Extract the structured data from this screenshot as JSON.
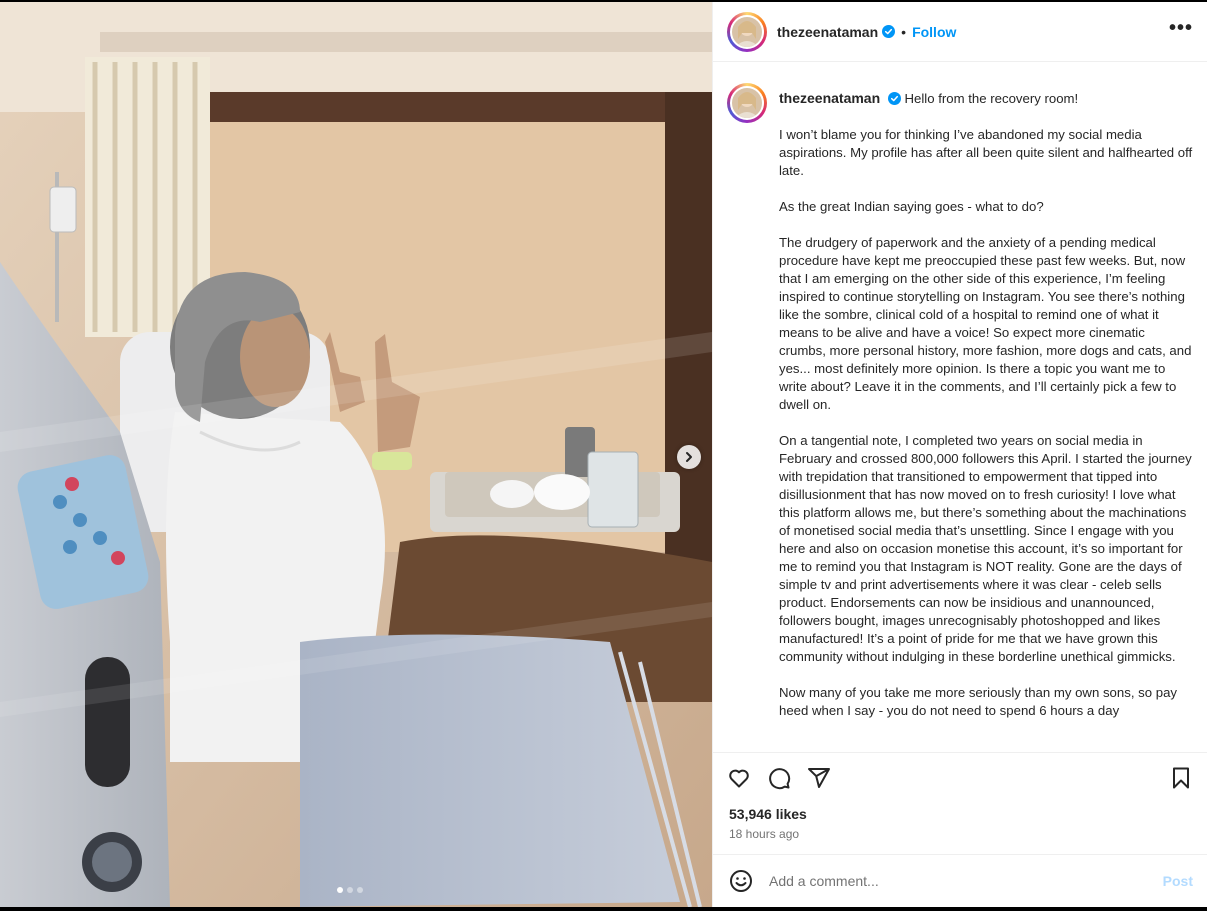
{
  "post": {
    "username": "thezeenataman",
    "verified": true,
    "follow_label": "Follow",
    "separator": "•",
    "more_label": "•••",
    "carousel": {
      "count": 3,
      "active_index": 0
    }
  },
  "caption": {
    "username": "thezeenataman",
    "first_line": "Hello from the recovery room!",
    "paragraphs": [
      "I won’t blame you for thinking I’ve abandoned my social media aspirations. My profile has after all been quite silent and halfhearted off late.",
      "As the great Indian saying goes - what to do?",
      "The drudgery of paperwork and the anxiety of a pending medical procedure have kept me preoccupied these past few weeks. But, now that I am emerging on the other side of this experience, I’m feeling inspired to continue storytelling on Instagram. You see there’s nothing like the sombre, clinical cold of a hospital to remind one of what it means to be alive and have a voice! So expect more cinematic crumbs, more personal history, more fashion, more dogs and cats, and yes... most definitely more opinion. Is there a topic you want me to write about? Leave it in the comments, and I’ll certainly pick a few to dwell on.",
      "On a tangential note, I completed two years on social media in February and crossed 800,000 followers this April. I started the journey with trepidation that transitioned to empowerment that tipped into disillusionment that has now moved on to fresh curiosity! I love what this platform allows me, but there’s something about the machinations of monetised social media that’s unsettling. Since I engage with you here and also on occasion monetise this account, it’s so important for me to remind you that Instagram is NOT reality. Gone are the days of simple tv and print advertisements where it was clear - celeb sells product. Endorsements can now be insidious and unannounced, followers bought, images unrecognisably photoshopped and likes manufactured! It’s a point of pride for me that we have grown this community without indulging in these borderline unethical gimmicks.",
      "Now many of you take me more seriously than my own sons, so pay heed when I say - you do not need to spend 6 hours a day"
    ]
  },
  "stats": {
    "likes": "53,946 likes",
    "time_ago": "18 hours ago"
  },
  "comment": {
    "placeholder": "Add a comment...",
    "post_label": "Post"
  },
  "colors": {
    "accent": "#0095f6",
    "post_disabled": "#b3dbff",
    "muted": "#737373",
    "text": "#262626"
  },
  "icons": {
    "like": "heart-icon",
    "comment": "comment-bubble-icon",
    "share": "paper-plane-icon",
    "save": "bookmark-icon",
    "emoji": "smiley-icon",
    "more": "more-options-icon",
    "next": "chevron-right-icon"
  }
}
